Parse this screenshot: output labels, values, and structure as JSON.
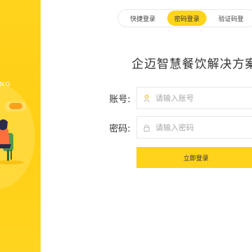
{
  "colors": {
    "accent": "#ffd21c",
    "panel": "#ffcf14",
    "pill": "#f9a11b",
    "text": "#333333",
    "placeholder": "#a9a9a9"
  },
  "left_panel": {
    "tagline": "ING"
  },
  "tabs": [
    {
      "label": "快捷登录",
      "active": false
    },
    {
      "label": "密码登录",
      "active": true
    },
    {
      "label": "验证码登",
      "active": false
    }
  ],
  "title": "企迈智慧餐饮解决方案",
  "form": {
    "account_label": "账号:",
    "account_placeholder": "请输入账号",
    "account_icon": "user-icon",
    "password_label": "密码:",
    "password_placeholder": "请输入密码",
    "password_icon": "lock-icon",
    "submit_label": "立即登录"
  }
}
